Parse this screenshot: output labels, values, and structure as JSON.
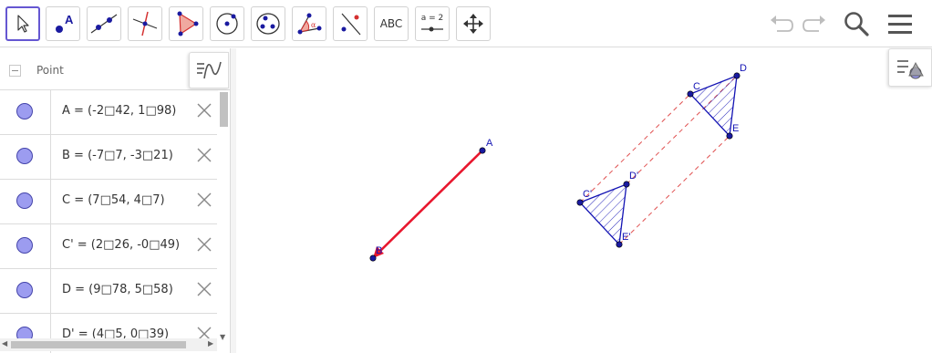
{
  "toolbar": {
    "tools": [
      {
        "name": "move-tool",
        "icon": "cursor-arrow-icon",
        "selected": true
      },
      {
        "name": "point-tool",
        "icon": "point-a-icon"
      },
      {
        "name": "line-tool",
        "icon": "line-through-points-icon"
      },
      {
        "name": "perpendicular-line-tool",
        "icon": "perpendicular-line-icon"
      },
      {
        "name": "polygon-tool",
        "icon": "polygon-icon"
      },
      {
        "name": "circle-tool",
        "icon": "circle-center-point-icon"
      },
      {
        "name": "circle-three-points-tool",
        "icon": "circle-three-points-icon"
      },
      {
        "name": "angle-tool",
        "icon": "angle-icon"
      },
      {
        "name": "reflect-tool",
        "icon": "reflect-about-line-icon"
      },
      {
        "name": "text-tool",
        "label": "ABC"
      },
      {
        "name": "slider-tool",
        "label": "a = 2"
      },
      {
        "name": "move-graphics-tool",
        "icon": "move-arrows-icon"
      }
    ],
    "undo_icon": "undo-icon",
    "redo_icon": "redo-icon",
    "search_icon": "search-icon",
    "menu_icon": "hamburger-menu-icon"
  },
  "algebra": {
    "group_label": "Point",
    "rows": [
      {
        "expr": "A = (-2□42, 1□98)"
      },
      {
        "expr": "B = (-7□7, -3□21)"
      },
      {
        "expr": "C = (7□54, 4□7)"
      },
      {
        "expr": "C' = (2□26, -0□49)"
      },
      {
        "expr": "D = (9□78, 5□58)"
      },
      {
        "expr": "D' = (4□5, 0□39)"
      }
    ]
  },
  "graphics": {
    "labels": {
      "A": "A",
      "B": "B",
      "C": "C",
      "D": "D",
      "E": "E",
      "C1": "C'",
      "D1": "D'",
      "E1": "E'"
    }
  },
  "colors": {
    "accent": "#6557d2",
    "vector": "#e8172e",
    "polygon": "#1414b4",
    "point_fill": "#1a1aa0",
    "dashed": "#e05050",
    "algebra_dot": "#9c9cf0"
  }
}
